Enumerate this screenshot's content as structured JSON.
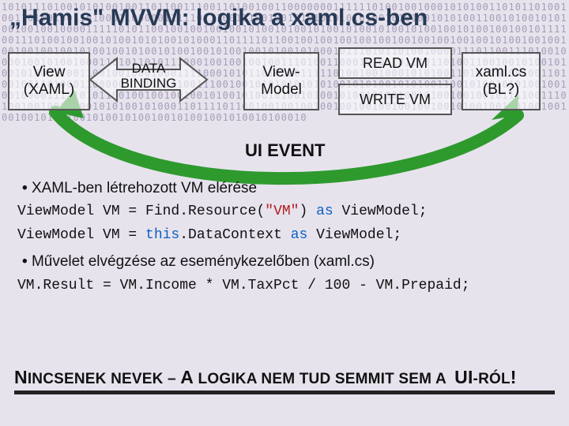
{
  "title": "„Hamis\" MVVM: logika a xaml.cs-ben",
  "diagram": {
    "view": "View\n(XAML)",
    "binding_top": "DATA",
    "binding_bot": "BINDING",
    "vm": "View-\nModel",
    "readvm": "READ VM",
    "writevm": "WRITE VM",
    "xamlcs": "xaml.cs\n(BL?)",
    "ui_event": "UI EVENT"
  },
  "bullet1": "XAML-ben létrehozott VM elérése",
  "bullet2": "Művelet elvégzése az eseménykezelőben (xaml.cs)",
  "code1a": "ViewModel VM = Find.Resource(",
  "code1b": "\"VM\"",
  "code1c": ") ",
  "code1d": "as",
  "code1e": " ViewModel;",
  "code2a": "ViewModel VM = ",
  "code2b": "this",
  "code2c": ".DataContext ",
  "code2d": "as",
  "code2e": " ViewModel;",
  "code3": "VM.Result = VM.Income * VM.TaxPct / 100 - VM.Prepaid;",
  "footer_big1": "N",
  "footer_rest1": "INCSENEK NEVEK – ",
  "footer_big2": "A",
  "footer_rest2": " LOGIKA NEM TUD SEMMIT SEM A ",
  "footer_big3": "UI",
  "footer_rest3": "-RÓL",
  "footer_bang": "!",
  "bg_bits": "10101110100101010010011011001110011010010011000000011111101001001000101010011010110100100110100100110100011000001111101110011100100101010101010100101010010101001100101001010100100100100001111101011001001001001001010010100101001010010100101001001010010010010111100111010010010010100101010010100011011110110010010010010010010010010010010010100100100100100100100101001001010010100100101001001010010100010111010110100100001110110011101001000010010100100011010110101110001001001001001110100110001010010111011010011001001010010100101000110011001001000100011110001010110100001111101001001000101010011010110100100110100100110100011000001111101110011100100101010101010100101010010101001100101001010100100100100001111101011001001001001001010010100101001010010100101001001010010010010111100111010010010010100101010010100011011110110010010010010010010010010010010010100100100100100100100101001001010010100100101001001010010100010"
}
